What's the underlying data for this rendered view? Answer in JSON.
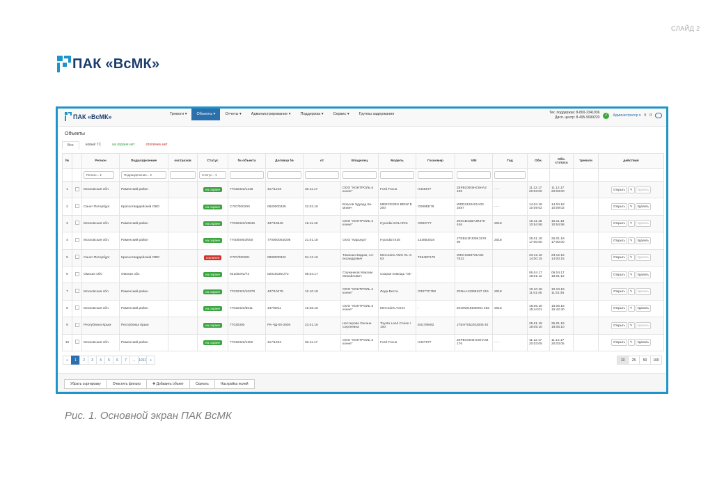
{
  "slide_number": "СЛАЙД 2",
  "brand": "ПАК «ВсМК»",
  "app": {
    "brand": "ПАК «ВсМК»",
    "nav": [
      "Тревоги ▾",
      "Объекты ▾",
      "Отчеты ▾",
      "Администрирование ▾",
      "Поддержка ▾",
      "Сервис ▾",
      "Группы задержания"
    ],
    "active_nav": 1,
    "support_line1": "Тех. поддержка: 8-800-2341936",
    "support_line2": "Дисп. центр: 8-495-9099220",
    "user": "Администратор ▾",
    "counter1": "0",
    "counter2": "0"
  },
  "page_title": "Объекты",
  "tabs": [
    "Все",
    "новый ТС",
    "на охране нет",
    "отключен нет"
  ],
  "columns": [
    "№",
    "",
    "Регион",
    "Подразделение",
    "окстрахов",
    "Статус",
    "№ объекта",
    "Договор №",
    "от",
    "Владелец",
    "Модель",
    "Госномер",
    "VIN",
    "Год",
    "Обн.",
    "Обн. статуса",
    "тревоги",
    "действия"
  ],
  "filters": {
    "region": "Регион... ▾",
    "division": "Подразделение... ▾",
    "status": "Статус... ▾"
  },
  "rows": [
    {
      "n": "1",
      "region": "Московская обл.",
      "division": "Раменский район",
      "status": "на охране",
      "status_color": "green",
      "obj": "77032323/1218",
      "contract": "417/1218",
      "date": "30.11.17",
      "owner": "ООО \"КОНТРОЛЬ в конне\"",
      "model": "Ford Focus",
      "plate": "Н426677",
      "vin": "Z6FBXXE5HC6HA2 106",
      "year": "- - -",
      "upd": "11.12.17 20:03:00",
      "upd_status": "11.12.17 20:03:00"
    },
    {
      "n": "2",
      "region": "Санкт-Петербург",
      "division": "Красногвардейский ОВО",
      "status": "на охране",
      "status_color": "green",
      "obj": "С787/000200",
      "contract": "0820000335",
      "date": "22.02.18",
      "owner": "Власов Эдуард Ки- мович",
      "model": "MERCEDES BENZ E 200",
      "plate": "О098ЕЕ78",
      "vin": "WDD2120421A00 3487",
      "year": "- - -",
      "upd": "14.04.18 10:09:02",
      "upd_status": "14.04.18 10:09:02"
    },
    {
      "n": "3",
      "region": "Московская обл.",
      "division": "Раменский район",
      "status": "на охране",
      "status_color": "green",
      "obj": "77032323/18546",
      "contract": "437/18546",
      "date": "15.11.18",
      "owner": "ООО \"КОНТРОЛЬ в конне\"",
      "model": "Hyundai SOLARIS",
      "plate": "О083777",
      "vin": "Z94CB41BAJR370 446",
      "year": "2018",
      "upd": "15.11.18 10:54:58",
      "upd_status": "15.11.18 10:54:58"
    },
    {
      "n": "4",
      "region": "Московская обл.",
      "division": "Раменский район",
      "status": "на охране",
      "status_color": "green",
      "obj": "770000003/000",
      "contract": "770000003/208",
      "date": "21.01.18",
      "owner": "ООО \"Карьера\"",
      "model": "Hyundai IX35",
      "plate": "133853018",
      "vin": "JTEBU3FJ00K1576 90",
      "year": "2018",
      "upd": "25.01.18 17:00:00",
      "upd_status": "25.01.18 17:00:00"
    },
    {
      "n": "5",
      "region": "Санкт-Петербург",
      "division": "Красногвардейский ОВО",
      "status": "отключен",
      "status_color": "red",
      "obj": "С787/000201",
      "contract": "0800000322",
      "date": "04.12.16",
      "owner": "Тимохин Вадим, Ал- ександрович",
      "model": "Mercedes AMG GL S 63",
      "plate": "Т654КР178",
      "vin": "WDC1668731A84 7622",
      "year": "",
      "upd": "23.12.16 14:00:15",
      "upd_status": "23.12.16 14:00:15"
    },
    {
      "n": "6",
      "region": "Омская обл.",
      "division": "Омская обл.",
      "status": "на охране",
      "status_color": "green",
      "obj": "02100201/72",
      "contract": "020100201/72",
      "date": "05.04.17",
      "owner": "Служенков Максим Михайлович",
      "model": "Скорая помощь \"03\"",
      "plate": "",
      "vin": "",
      "year": "",
      "upd": "06.04.17 18:01:12",
      "upd_status": "06.04.17 18:01:12"
    },
    {
      "n": "7",
      "region": "Московская обл.",
      "division": "Раменский район",
      "status": "на охране",
      "status_color": "green",
      "obj": "77032323/10278",
      "contract": "437/10278",
      "date": "10.10.18",
      "owner": "ООО \"КОНТРОЛЬ в конне\"",
      "model": "Лада Веста",
      "plate": "О337ТС750",
      "vin": "Z0NAA11096227 215",
      "year": "2018",
      "upd": "10.10.18 11:51:45",
      "upd_status": "10.10.18 11:51:45"
    },
    {
      "n": "8",
      "region": "Московская обл.",
      "division": "Раменский район",
      "status": "на охране",
      "status_color": "green",
      "obj": "77032323/8011",
      "contract": "437/8011",
      "date": "15.08.18",
      "owner": "ООО \"КОНТРОЛЬ в конне\"",
      "model": "Mercedes Actros",
      "plate": "-",
      "vin": "Z9UW018630091 262",
      "year": "2018",
      "upd": "18.06.18 15:44:01",
      "upd_status": "18.06.18 15:42:40"
    },
    {
      "n": "9",
      "region": "Республика Крым",
      "division": "Республика Крым",
      "status": "на охране",
      "status_color": "green",
      "obj": "77030300",
      "contract": "РК-ЧД-00-2800",
      "date": "23.01.18",
      "owner": "Нестерова Оксана Сергеевна",
      "model": "Toyota Land Cruise r 100",
      "plate": "Е817МК82",
      "vin": "JTEHT05J202005 40",
      "year": "",
      "upd": "25.01.18 18:05:10",
      "upd_status": "25.01.18 18:05:10"
    },
    {
      "n": "10",
      "region": "Московская обл.",
      "division": "Раменский район",
      "status": "на охране",
      "status_color": "green",
      "obj": "77032323/1252",
      "contract": "417/1252",
      "date": "30.11.17",
      "owner": "ООО \"КОНТРОЛЬ в конне\"",
      "model": "Ford Focus",
      "plate": "Н427977",
      "vin": "Z6FBXXE5HC6HA34 176",
      "year": "- - -",
      "upd": "11.12.17 20:03:05",
      "upd_status": "11.12.17 20:03:05"
    }
  ],
  "row_actions": {
    "open": "Открыть",
    "edit": "✎",
    "delete": "Удалить"
  },
  "pagination": [
    "«",
    "1",
    "2",
    "3",
    "4",
    "5",
    "6",
    "7",
    "...",
    "1011",
    "»"
  ],
  "page_sizes": [
    "10",
    "25",
    "50",
    "100"
  ],
  "bottom_buttons": [
    "Убрать сортировку",
    "Очистить фильтр",
    "✚ Добавить объект",
    "Скачать",
    "Настройка полей"
  ],
  "caption": "Рис. 1. Основной экран ПАК ВсМК"
}
